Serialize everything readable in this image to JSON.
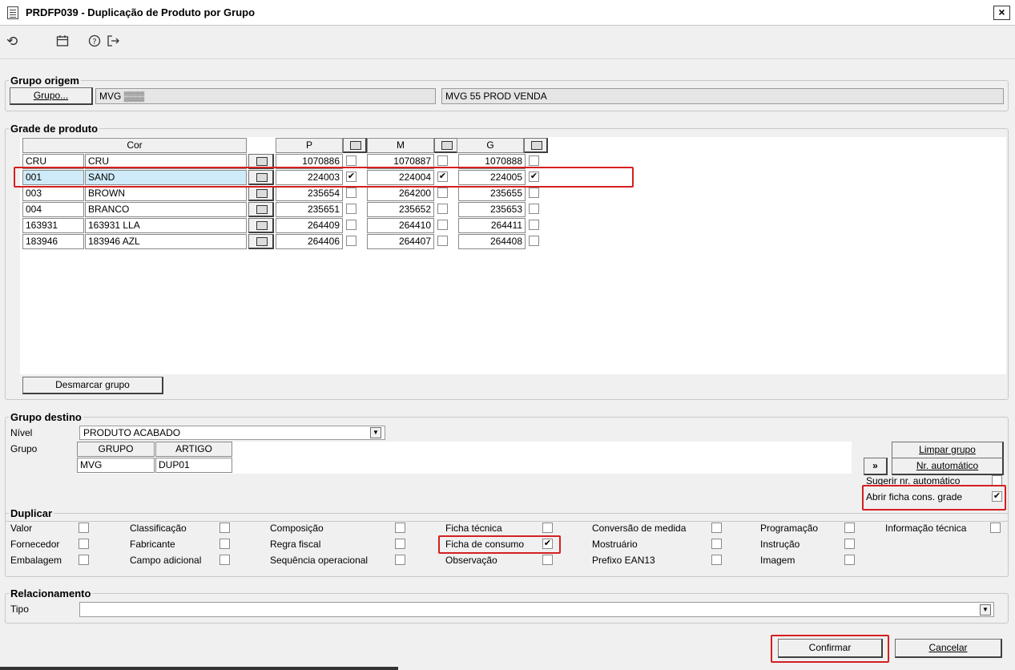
{
  "window": {
    "title": "PRDFP039 - Duplicação de Produto por Grupo",
    "close": "×"
  },
  "toolbar": {
    "icons": [
      "undo-icon",
      "calendar-icon",
      "help-icon",
      "exit-icon"
    ],
    "undo": "⟲",
    "calendar": "▭",
    "help": "?",
    "exit": "↦"
  },
  "origem": {
    "legend": "Grupo origem",
    "button": "Grupo...",
    "code": "MVG ▒▒▒",
    "description": "MVG 55 PROD VENDA"
  },
  "grade": {
    "legend": "Grade de produto",
    "cor_header": "Cor",
    "sizes": [
      "P",
      "M",
      "G"
    ],
    "rows": [
      {
        "code": "CRU",
        "name": "CRU",
        "vals": [
          "1070886",
          "1070887",
          "1070888"
        ],
        "checks": [
          false,
          false,
          false
        ]
      },
      {
        "code": "001",
        "name": "SAND",
        "vals": [
          "224003",
          "224004",
          "224005"
        ],
        "checks": [
          true,
          true,
          true
        ]
      },
      {
        "code": "003",
        "name": "BROWN",
        "vals": [
          "235654",
          "264200",
          "235655"
        ],
        "checks": [
          false,
          false,
          false
        ]
      },
      {
        "code": "004",
        "name": "BRANCO",
        "vals": [
          "235651",
          "235652",
          "235653"
        ],
        "checks": [
          false,
          false,
          false
        ]
      },
      {
        "code": "163931",
        "name": "163931 LLA",
        "vals": [
          "264409",
          "264410",
          "264411"
        ],
        "checks": [
          false,
          false,
          false
        ]
      },
      {
        "code": "183946",
        "name": "183946 AZL",
        "vals": [
          "264406",
          "264407",
          "264408"
        ],
        "checks": [
          false,
          false,
          false
        ]
      }
    ],
    "desmarcar": "Desmarcar grupo"
  },
  "destino": {
    "legend": "Grupo destino",
    "nivel_label": "Nível",
    "nivel_value": "PRODUTO ACABADO",
    "grupo_label": "Grupo",
    "col_grupo": "GRUPO",
    "col_artigo": "ARTIGO",
    "grupo_value": "MVG",
    "artigo_value": "DUP01",
    "limpar": "Limpar grupo",
    "arrow": "»",
    "nr_auto": "Nr. automático",
    "sugerir": "Sugerir nr. automático",
    "sugerir_checked": false,
    "abrir": "Abrir ficha cons. grade",
    "abrir_checked": true
  },
  "duplicar": {
    "legend": "Duplicar",
    "items": [
      {
        "label": "Valor",
        "checked": false
      },
      {
        "label": "Fornecedor",
        "checked": false
      },
      {
        "label": "Embalagem",
        "checked": false
      },
      {
        "label": "Classificação",
        "checked": false
      },
      {
        "label": "Fabricante",
        "checked": false
      },
      {
        "label": "Campo adicional",
        "checked": false
      },
      {
        "label": "Composição",
        "checked": false
      },
      {
        "label": "Regra fiscal",
        "checked": false
      },
      {
        "label": "Sequência operacional",
        "checked": false
      },
      {
        "label": "Ficha técnica",
        "checked": false
      },
      {
        "label": "Ficha de consumo",
        "checked": true
      },
      {
        "label": "Observação",
        "checked": false
      },
      {
        "label": "Conversão de medida",
        "checked": false
      },
      {
        "label": "Mostruário",
        "checked": false
      },
      {
        "label": "Prefixo EAN13",
        "checked": false
      },
      {
        "label": "Programação",
        "checked": false
      },
      {
        "label": "Instrução",
        "checked": false
      },
      {
        "label": "Imagem",
        "checked": false
      },
      {
        "label": "Informação técnica",
        "checked": false
      }
    ]
  },
  "relacionamento": {
    "legend": "Relacionamento",
    "tipo_label": "Tipo",
    "tipo_value": ""
  },
  "actions": {
    "confirmar": "Confirmar",
    "cancelar": "Cancelar"
  },
  "colors": {
    "highlight_red": "#d42020",
    "selected_row": "#cfeaf8",
    "panel_bg": "#f0f0f0"
  }
}
